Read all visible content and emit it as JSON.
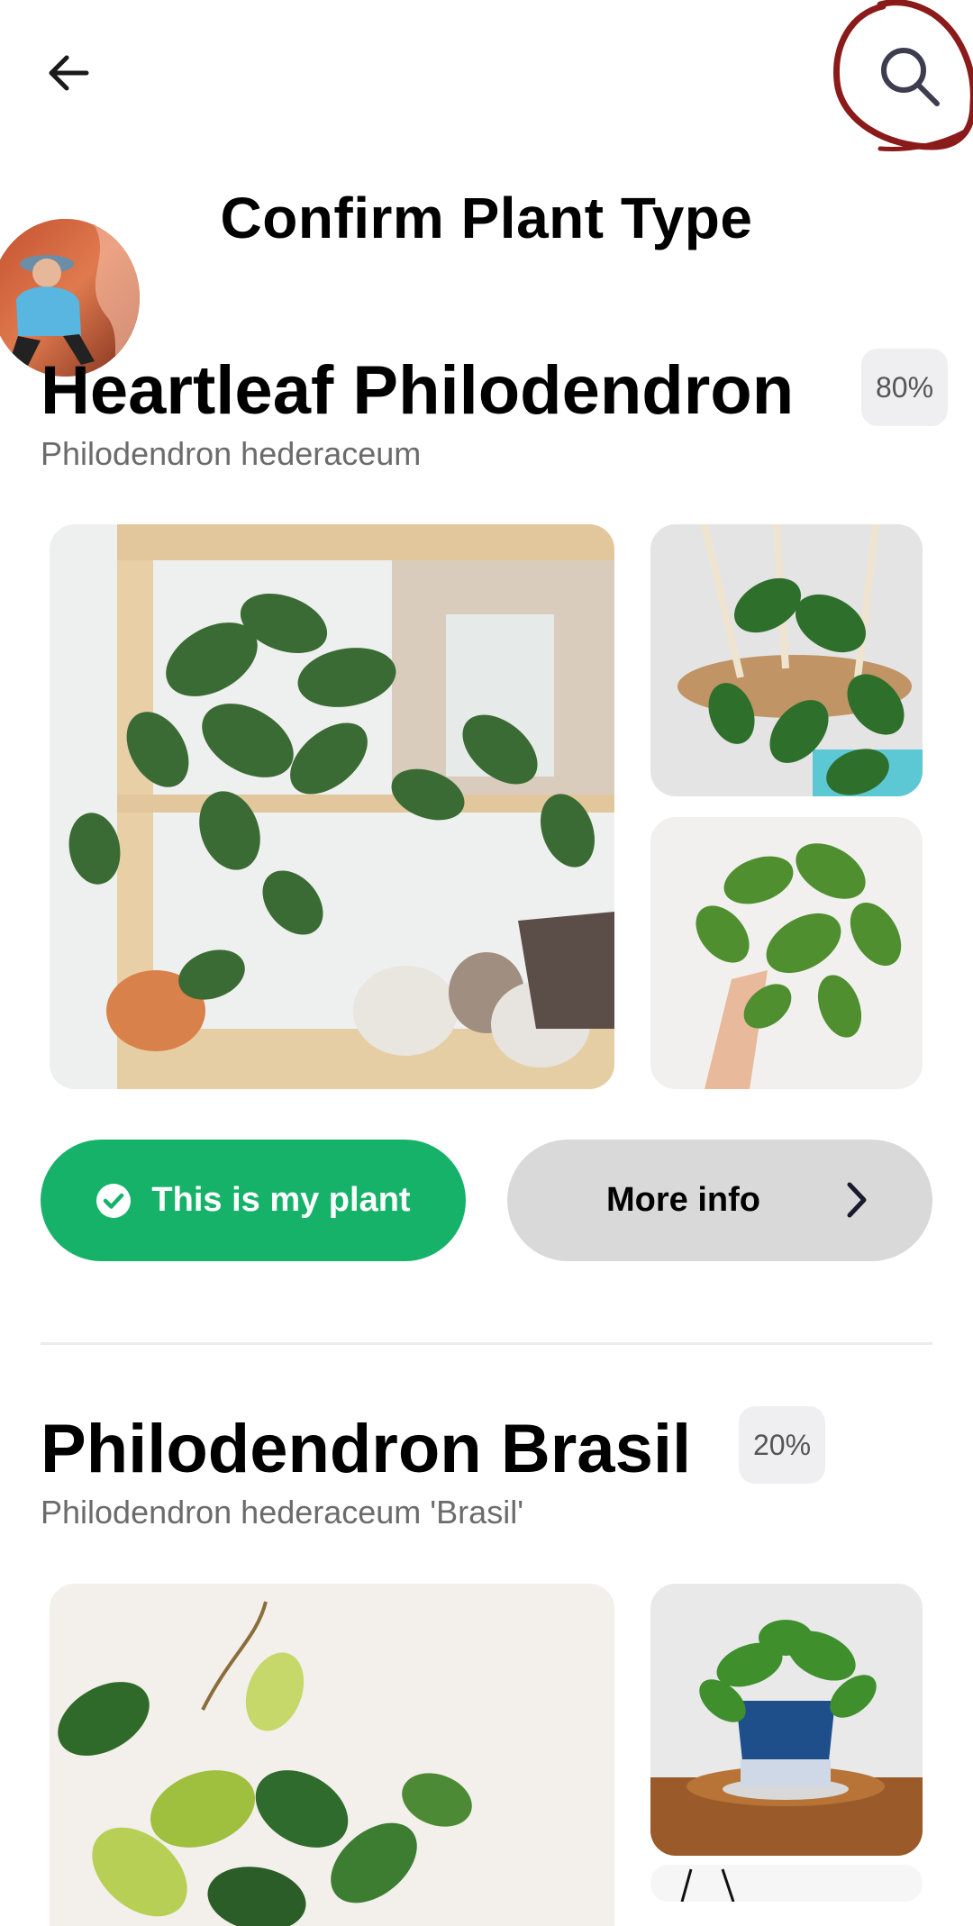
{
  "header": {
    "title": "Confirm Plant Type"
  },
  "icons": {
    "back": "arrow-left-icon",
    "search": "search-icon",
    "confirm": "check-circle-icon",
    "more": "chevron-right-icon"
  },
  "colors": {
    "confirm_green": "#17b26a",
    "annotation_red": "#8b1a1a",
    "badge_bg": "#efeff2"
  },
  "results": [
    {
      "common_name": "Heartleaf Philodendron",
      "scientific_name": "Philodendron hederaceum",
      "confidence": "80%",
      "confirm_label": "This is my plant",
      "more_label": "More info"
    },
    {
      "common_name": "Philodendron Brasil",
      "scientific_name": "Philodendron hederaceum 'Brasil'",
      "confidence": "20%"
    }
  ]
}
